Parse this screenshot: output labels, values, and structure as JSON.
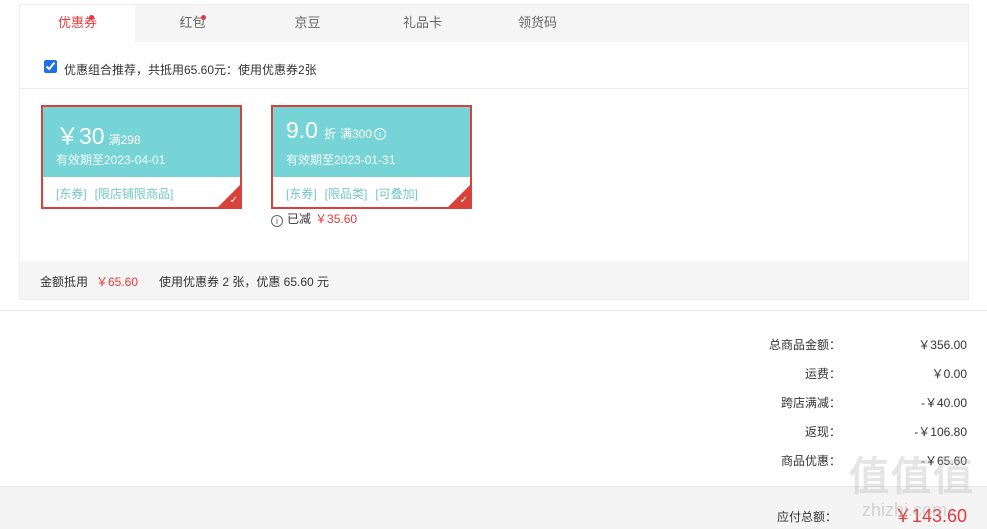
{
  "tabs": [
    {
      "label": "优惠券",
      "active": true,
      "has_dot": true
    },
    {
      "label": "红包",
      "active": false,
      "has_dot": true
    },
    {
      "label": "京豆",
      "active": false,
      "has_dot": false
    },
    {
      "label": "礼品卡",
      "active": false,
      "has_dot": false
    },
    {
      "label": "领货码",
      "active": false,
      "has_dot": false
    }
  ],
  "combo": {
    "checked": true,
    "text": "优惠组合推荐，共抵用65.60元：使用优惠券2张"
  },
  "coupons": [
    {
      "amount": "￥30",
      "condition": "满298",
      "valid": "有效期至2023-04-01",
      "tags": [
        "[东券]",
        "[限店铺限商品]"
      ],
      "selected": true
    },
    {
      "amount": "9.0",
      "unit": "折",
      "condition": "满300",
      "valid": "有效期至2023-01-31",
      "tags": [
        "[东券]",
        "[限品类]",
        "[可叠加]"
      ],
      "selected": true,
      "reduced_label": "已减",
      "reduced_value": "￥35.60"
    }
  ],
  "summary": {
    "label": "金额抵用",
    "amount": "￥65.60",
    "desc": "使用优惠券 2 张，优惠 65.60 元"
  },
  "totals": [
    {
      "label": "总商品金额：",
      "value": "￥356.00"
    },
    {
      "label": "运费：",
      "value": "￥0.00"
    },
    {
      "label": "跨店满减：",
      "value": "-￥40.00"
    },
    {
      "label": "返现：",
      "value": "-￥106.80"
    },
    {
      "label": "商品优惠：",
      "value": "-￥65.60"
    }
  ],
  "payable": {
    "label": "应付总额：",
    "value": "￥143.60"
  },
  "watermark": {
    "text": "值值值",
    "site": "zhizhi.com"
  },
  "colors": {
    "accent_red": "#e4393c",
    "coupon_teal": "#76d3d6",
    "card_border": "#d9423b"
  }
}
